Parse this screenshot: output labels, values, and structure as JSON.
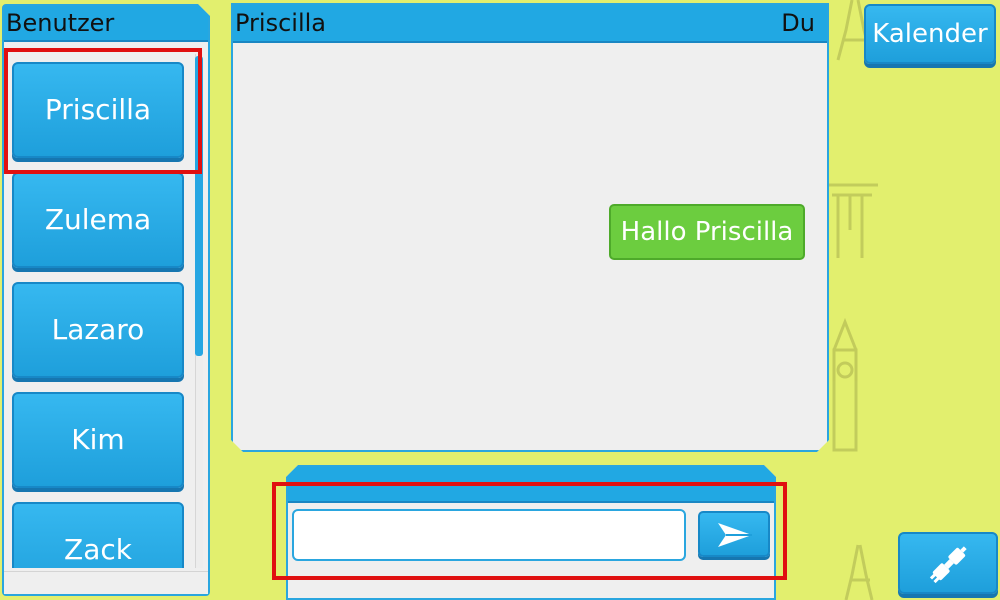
{
  "sidebar": {
    "title": "Benutzer",
    "users": [
      {
        "name": "Priscilla"
      },
      {
        "name": "Zulema"
      },
      {
        "name": "Lazaro"
      },
      {
        "name": "Kim"
      },
      {
        "name": "Zack"
      }
    ],
    "selected_user": "Priscilla"
  },
  "chat": {
    "title": "Priscilla",
    "me_label": "Du",
    "messages": [
      {
        "text": "Hallo Priscilla",
        "from": "Du"
      }
    ]
  },
  "compose": {
    "input_value": "",
    "send_icon": "paper-plane-icon"
  },
  "toolbar": {
    "calendar_label": "Kalender",
    "disconnect_icon": "plug-icon"
  },
  "colors": {
    "background": "#e2ef6e",
    "accent": "#21a8e3",
    "message_bubble": "#6ccd3f",
    "highlight": "#e01010"
  }
}
